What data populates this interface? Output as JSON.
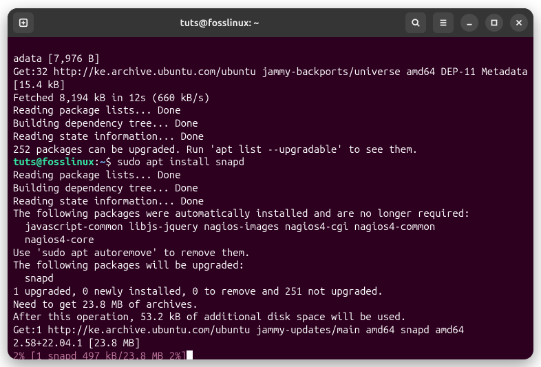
{
  "titlebar": {
    "title": "tuts@fosslinux: ~"
  },
  "prompt": {
    "user_host": "tuts@fosslinux",
    "sep1": ":",
    "path": "~",
    "sep2": "$ ",
    "command": "sudo apt install snapd"
  },
  "lines": {
    "l0": "adata [7,976 B]",
    "l1": "Get:32 http://ke.archive.ubuntu.com/ubuntu jammy-backports/universe amd64 DEP-11 Metadata [15.4 kB]",
    "l2": "Fetched 8,194 kB in 12s (660 kB/s)",
    "l3": "Reading package lists... Done",
    "l4": "Building dependency tree... Done",
    "l5": "Reading state information... Done",
    "l6": "252 packages can be upgraded. Run 'apt list --upgradable' to see them.",
    "l7": "Reading package lists... Done",
    "l8": "Building dependency tree... Done",
    "l9": "Reading state information... Done",
    "l10": "The following packages were automatically installed and are no longer required:",
    "l11": "  javascript-common libjs-jquery nagios-images nagios4-cgi nagios4-common",
    "l12": "  nagios4-core",
    "l13": "Use 'sudo apt autoremove' to remove them.",
    "l14": "The following packages will be upgraded:",
    "l15": "  snapd",
    "l16": "1 upgraded, 0 newly installed, 0 to remove and 251 not upgraded.",
    "l17": "Need to get 23.8 MB of archives.",
    "l18": "After this operation, 53.2 kB of additional disk space will be used.",
    "l19": "Get:1 http://ke.archive.ubuntu.com/ubuntu jammy-updates/main amd64 snapd amd64 2.58+22.04.1 [23.8 MB]"
  },
  "progress": {
    "text": "2% [1 snapd 497 kB/23.8 MB 2%]"
  }
}
